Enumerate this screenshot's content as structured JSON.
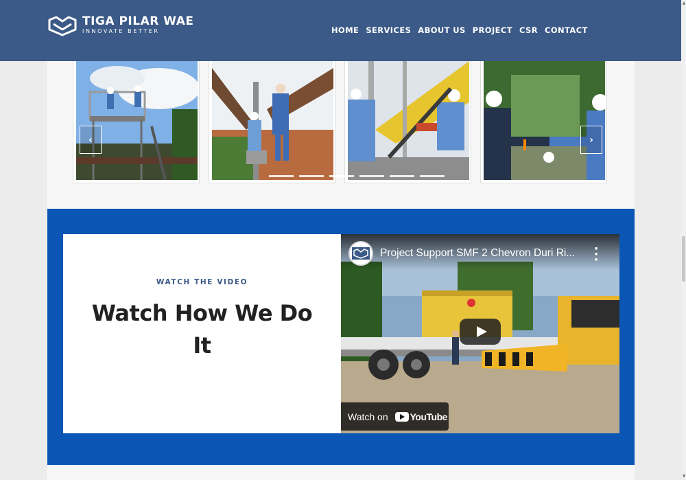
{
  "header": {
    "logo": {
      "name": "TIGA PILAR WAE",
      "tagline": "INNOVATE BETTER",
      "icon": "tiga-pilar-logo-icon"
    },
    "nav": [
      "HOME",
      "SERVICES",
      "ABOUT US",
      "PROJECT",
      "CSR",
      "CONTACT"
    ]
  },
  "carousel": {
    "prev_label": "‹",
    "next_label": "›",
    "dot_count": 6,
    "slides": [
      {
        "alt": "workers on a scaffold platform under cloudy sky"
      },
      {
        "alt": "worker at a pipeline valve"
      },
      {
        "alt": "technicians working on yellow pipe"
      },
      {
        "alt": "workers in hard hats at pipe rack"
      }
    ]
  },
  "video_section": {
    "eyebrow": "WATCH THE VIDEO",
    "title": "Watch How We Do It",
    "video": {
      "title": "Project Support SMF 2 Chevron Duri Ri...",
      "watch_on": "Watch on",
      "platform": "YouTube"
    }
  },
  "colors": {
    "header_bg": "#3b5a87",
    "section_bg": "#0b56b5",
    "title_text": "#222222",
    "eyebrow_text": "#3b5a87"
  }
}
